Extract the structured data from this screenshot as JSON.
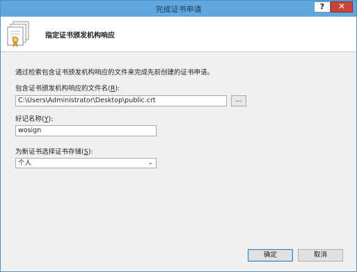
{
  "window": {
    "title": "完成证书申请",
    "help_label": "?",
    "close_label": "✕"
  },
  "header": {
    "title": "指定证书颁发机构响应",
    "icon": "certificate-icon"
  },
  "body": {
    "intro": "通过检索包含证书颁发机构响应的文件来完成先前创建的证书申请。",
    "file_label_prefix": "包含证书颁发机构响应的文件名(",
    "file_label_key": "R",
    "file_label_suffix": "):",
    "file_value": "C:\\Users\\Administrator\\Desktop\\public.crt",
    "browse_label": "...",
    "friendly_label_prefix": "好记名称(",
    "friendly_label_key": "Y",
    "friendly_label_suffix": "):",
    "friendly_value": "wosign",
    "store_label_prefix": "为新证书选择证书存储(",
    "store_label_key": "S",
    "store_label_suffix": "):",
    "store_value": "个人",
    "store_arrow": "⌄"
  },
  "buttons": {
    "ok": "确定",
    "cancel": "取消"
  },
  "colors": {
    "titlebar": "#5fa8dd",
    "close": "#c9453c",
    "dialog_bg": "#f0f0f0"
  }
}
